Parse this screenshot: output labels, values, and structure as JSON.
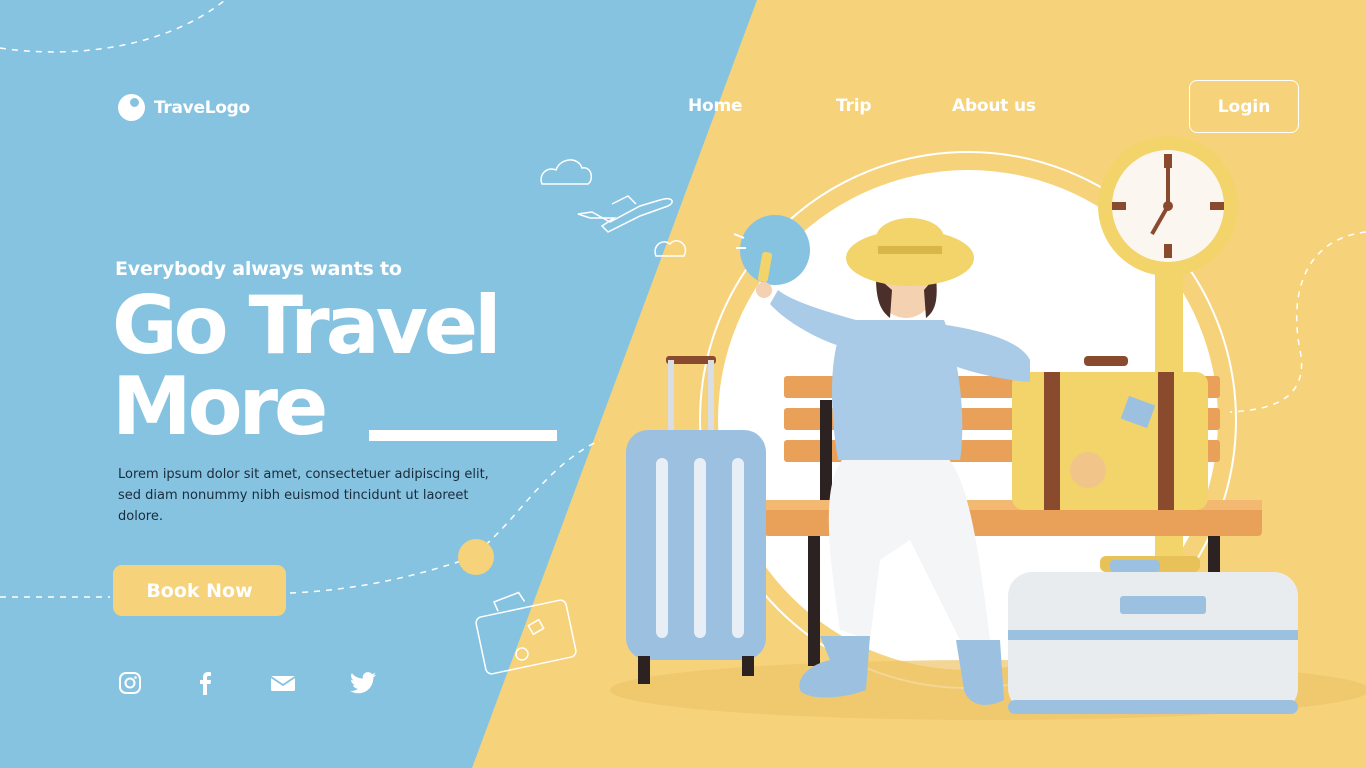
{
  "brand": {
    "name": "TraveLogo"
  },
  "nav": {
    "items": [
      {
        "label": "Home"
      },
      {
        "label": "Trip"
      },
      {
        "label": "About us"
      }
    ],
    "login_label": "Login"
  },
  "hero": {
    "eyebrow": "Everybody always wants to",
    "title_line1": "Go Travel",
    "title_line2": "More",
    "description": "Lorem ipsum dolor sit amet, consectetuer adipiscing elit, sed diam nonummy nibh euismod tincidunt ut laoreet dolore.",
    "cta_label": "Book Now"
  },
  "social": [
    {
      "icon": "instagram-icon"
    },
    {
      "icon": "facebook-icon"
    },
    {
      "icon": "mail-icon"
    },
    {
      "icon": "twitter-icon"
    }
  ],
  "colors": {
    "blue": "#86c3e0",
    "yellow": "#f6d27a",
    "text_dark": "#1b2b3c",
    "white": "#ffffff"
  }
}
